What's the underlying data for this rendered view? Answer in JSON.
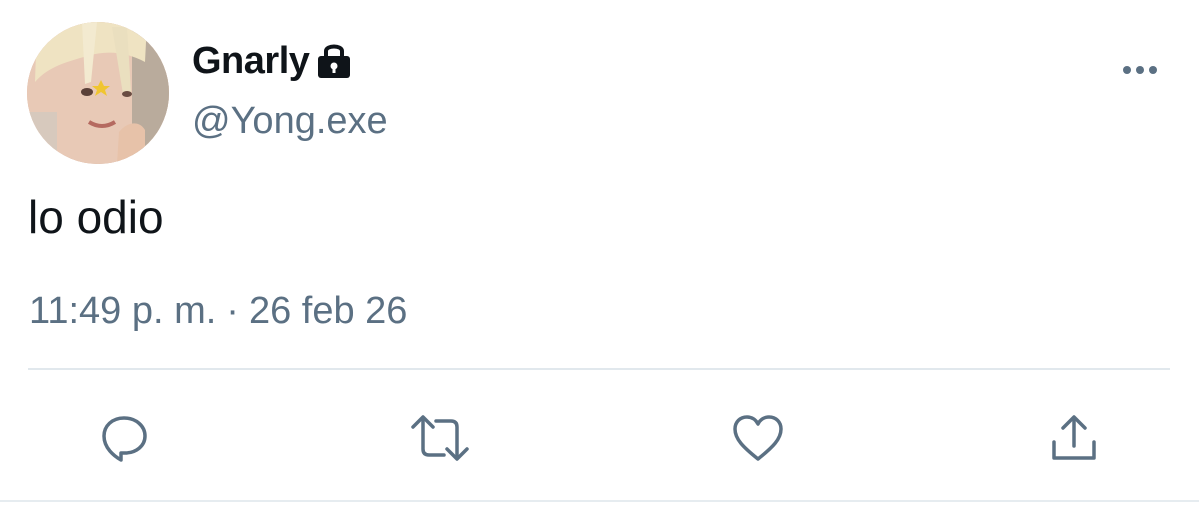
{
  "tweet": {
    "author": {
      "display_name": "Gnarly",
      "handle": "@Yong.exe",
      "protected_icon": "lock-icon",
      "avatar": "avatar-photo"
    },
    "text": "lo odio",
    "time": "11:49 p. m.",
    "separator": "·",
    "date": "26 feb 26",
    "more_icon": "more-options-icon",
    "actions": [
      {
        "name": "reply",
        "icon": "reply-icon"
      },
      {
        "name": "retweet",
        "icon": "retweet-icon"
      },
      {
        "name": "like",
        "icon": "heart-icon"
      },
      {
        "name": "share",
        "icon": "share-icon"
      }
    ]
  },
  "colors": {
    "text_primary": "#0f1419",
    "text_secondary": "#5b7083",
    "divider": "#e1e8ed"
  }
}
